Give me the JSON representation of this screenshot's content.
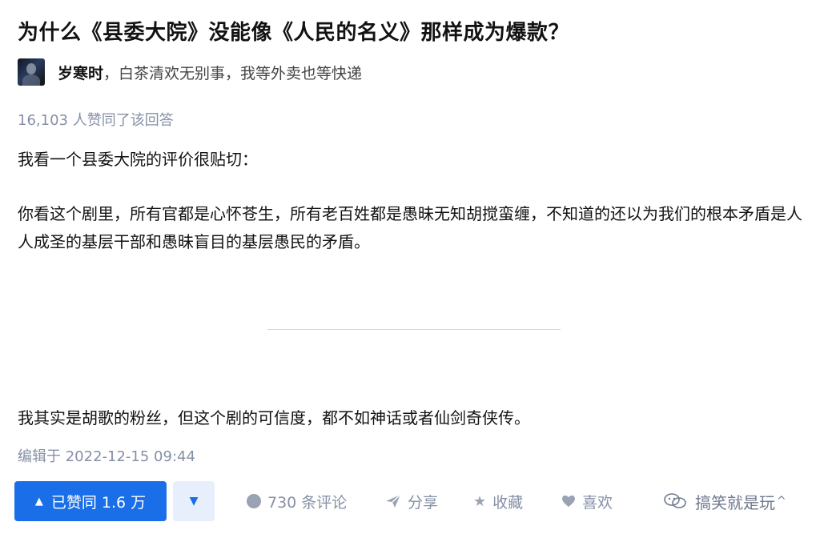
{
  "question": {
    "title": "为什么《县委大院》没能像《人民的名义》那样成为爆款？"
  },
  "author": {
    "name": "岁寒时",
    "bio": "，白茶清欢无别事，我等外卖也等快递"
  },
  "answer": {
    "upvote_text": "16,103 人赞同了该回答",
    "paragraphs": [
      "我看一个县委大院的评价很贴切：",
      "你看这个剧里，所有官都是心怀苍生，所有老百姓都是愚昧无知胡搅蛮缠，不知道的还以为我们的根本矛盾是人人成圣的基层干部和愚昧盲目的基层愚民的矛盾。",
      "我其实是胡歌的粉丝，但这个剧的可信度，都不如神话或者仙剑奇侠传。"
    ],
    "edited": "编辑于 2022-12-15 09:44"
  },
  "actions": {
    "vote_label": "已赞同 1.6 万",
    "comment_label": "730 条评论",
    "share_label": "分享",
    "favorite_label": "收藏",
    "like_label": "喜欢"
  },
  "watermark": {
    "text": "搞笑就是玩"
  },
  "icons": {
    "vote": "triangle-up-icon",
    "downvote": "triangle-down-icon",
    "comment": "comment-bubble-icon",
    "share": "paper-plane-icon",
    "favorite": "star-icon",
    "like": "heart-icon",
    "watermark": "wechat-logo-icon",
    "more": "caret-up-icon"
  },
  "colors": {
    "primary": "#1a6fe8",
    "primary_light": "#e8effc",
    "muted_text": "#8590a6"
  }
}
